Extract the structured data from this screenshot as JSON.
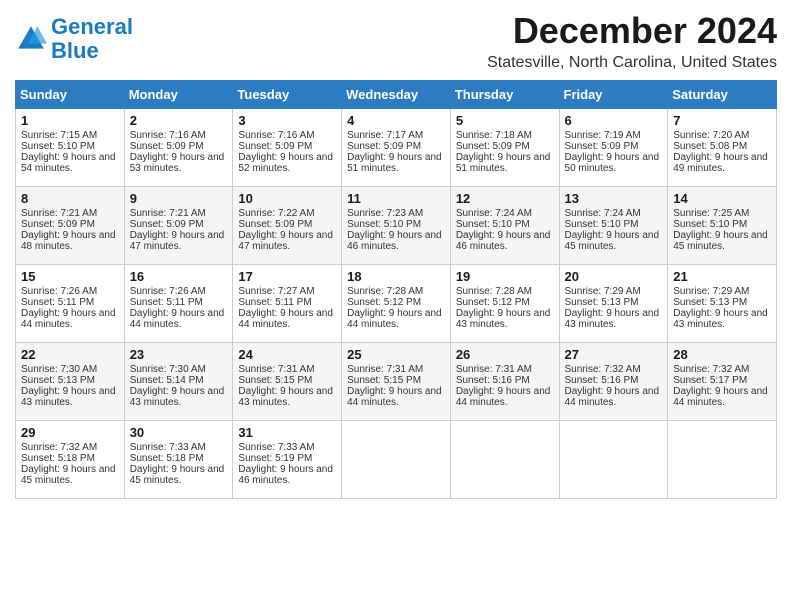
{
  "logo": {
    "line1": "General",
    "line2": "Blue"
  },
  "title": "December 2024",
  "location": "Statesville, North Carolina, United States",
  "days_of_week": [
    "Sunday",
    "Monday",
    "Tuesday",
    "Wednesday",
    "Thursday",
    "Friday",
    "Saturday"
  ],
  "weeks": [
    [
      {
        "day": "1",
        "sunrise": "Sunrise: 7:15 AM",
        "sunset": "Sunset: 5:10 PM",
        "daylight": "Daylight: 9 hours and 54 minutes."
      },
      {
        "day": "2",
        "sunrise": "Sunrise: 7:16 AM",
        "sunset": "Sunset: 5:09 PM",
        "daylight": "Daylight: 9 hours and 53 minutes."
      },
      {
        "day": "3",
        "sunrise": "Sunrise: 7:16 AM",
        "sunset": "Sunset: 5:09 PM",
        "daylight": "Daylight: 9 hours and 52 minutes."
      },
      {
        "day": "4",
        "sunrise": "Sunrise: 7:17 AM",
        "sunset": "Sunset: 5:09 PM",
        "daylight": "Daylight: 9 hours and 51 minutes."
      },
      {
        "day": "5",
        "sunrise": "Sunrise: 7:18 AM",
        "sunset": "Sunset: 5:09 PM",
        "daylight": "Daylight: 9 hours and 51 minutes."
      },
      {
        "day": "6",
        "sunrise": "Sunrise: 7:19 AM",
        "sunset": "Sunset: 5:09 PM",
        "daylight": "Daylight: 9 hours and 50 minutes."
      },
      {
        "day": "7",
        "sunrise": "Sunrise: 7:20 AM",
        "sunset": "Sunset: 5:08 PM",
        "daylight": "Daylight: 9 hours and 49 minutes."
      }
    ],
    [
      {
        "day": "8",
        "sunrise": "Sunrise: 7:21 AM",
        "sunset": "Sunset: 5:09 PM",
        "daylight": "Daylight: 9 hours and 48 minutes."
      },
      {
        "day": "9",
        "sunrise": "Sunrise: 7:21 AM",
        "sunset": "Sunset: 5:09 PM",
        "daylight": "Daylight: 9 hours and 47 minutes."
      },
      {
        "day": "10",
        "sunrise": "Sunrise: 7:22 AM",
        "sunset": "Sunset: 5:09 PM",
        "daylight": "Daylight: 9 hours and 47 minutes."
      },
      {
        "day": "11",
        "sunrise": "Sunrise: 7:23 AM",
        "sunset": "Sunset: 5:10 PM",
        "daylight": "Daylight: 9 hours and 46 minutes."
      },
      {
        "day": "12",
        "sunrise": "Sunrise: 7:24 AM",
        "sunset": "Sunset: 5:10 PM",
        "daylight": "Daylight: 9 hours and 46 minutes."
      },
      {
        "day": "13",
        "sunrise": "Sunrise: 7:24 AM",
        "sunset": "Sunset: 5:10 PM",
        "daylight": "Daylight: 9 hours and 45 minutes."
      },
      {
        "day": "14",
        "sunrise": "Sunrise: 7:25 AM",
        "sunset": "Sunset: 5:10 PM",
        "daylight": "Daylight: 9 hours and 45 minutes."
      }
    ],
    [
      {
        "day": "15",
        "sunrise": "Sunrise: 7:26 AM",
        "sunset": "Sunset: 5:11 PM",
        "daylight": "Daylight: 9 hours and 44 minutes."
      },
      {
        "day": "16",
        "sunrise": "Sunrise: 7:26 AM",
        "sunset": "Sunset: 5:11 PM",
        "daylight": "Daylight: 9 hours and 44 minutes."
      },
      {
        "day": "17",
        "sunrise": "Sunrise: 7:27 AM",
        "sunset": "Sunset: 5:11 PM",
        "daylight": "Daylight: 9 hours and 44 minutes."
      },
      {
        "day": "18",
        "sunrise": "Sunrise: 7:28 AM",
        "sunset": "Sunset: 5:12 PM",
        "daylight": "Daylight: 9 hours and 44 minutes."
      },
      {
        "day": "19",
        "sunrise": "Sunrise: 7:28 AM",
        "sunset": "Sunset: 5:12 PM",
        "daylight": "Daylight: 9 hours and 43 minutes."
      },
      {
        "day": "20",
        "sunrise": "Sunrise: 7:29 AM",
        "sunset": "Sunset: 5:13 PM",
        "daylight": "Daylight: 9 hours and 43 minutes."
      },
      {
        "day": "21",
        "sunrise": "Sunrise: 7:29 AM",
        "sunset": "Sunset: 5:13 PM",
        "daylight": "Daylight: 9 hours and 43 minutes."
      }
    ],
    [
      {
        "day": "22",
        "sunrise": "Sunrise: 7:30 AM",
        "sunset": "Sunset: 5:13 PM",
        "daylight": "Daylight: 9 hours and 43 minutes."
      },
      {
        "day": "23",
        "sunrise": "Sunrise: 7:30 AM",
        "sunset": "Sunset: 5:14 PM",
        "daylight": "Daylight: 9 hours and 43 minutes."
      },
      {
        "day": "24",
        "sunrise": "Sunrise: 7:31 AM",
        "sunset": "Sunset: 5:15 PM",
        "daylight": "Daylight: 9 hours and 43 minutes."
      },
      {
        "day": "25",
        "sunrise": "Sunrise: 7:31 AM",
        "sunset": "Sunset: 5:15 PM",
        "daylight": "Daylight: 9 hours and 44 minutes."
      },
      {
        "day": "26",
        "sunrise": "Sunrise: 7:31 AM",
        "sunset": "Sunset: 5:16 PM",
        "daylight": "Daylight: 9 hours and 44 minutes."
      },
      {
        "day": "27",
        "sunrise": "Sunrise: 7:32 AM",
        "sunset": "Sunset: 5:16 PM",
        "daylight": "Daylight: 9 hours and 44 minutes."
      },
      {
        "day": "28",
        "sunrise": "Sunrise: 7:32 AM",
        "sunset": "Sunset: 5:17 PM",
        "daylight": "Daylight: 9 hours and 44 minutes."
      }
    ],
    [
      {
        "day": "29",
        "sunrise": "Sunrise: 7:32 AM",
        "sunset": "Sunset: 5:18 PM",
        "daylight": "Daylight: 9 hours and 45 minutes."
      },
      {
        "day": "30",
        "sunrise": "Sunrise: 7:33 AM",
        "sunset": "Sunset: 5:18 PM",
        "daylight": "Daylight: 9 hours and 45 minutes."
      },
      {
        "day": "31",
        "sunrise": "Sunrise: 7:33 AM",
        "sunset": "Sunset: 5:19 PM",
        "daylight": "Daylight: 9 hours and 46 minutes."
      },
      null,
      null,
      null,
      null
    ]
  ]
}
